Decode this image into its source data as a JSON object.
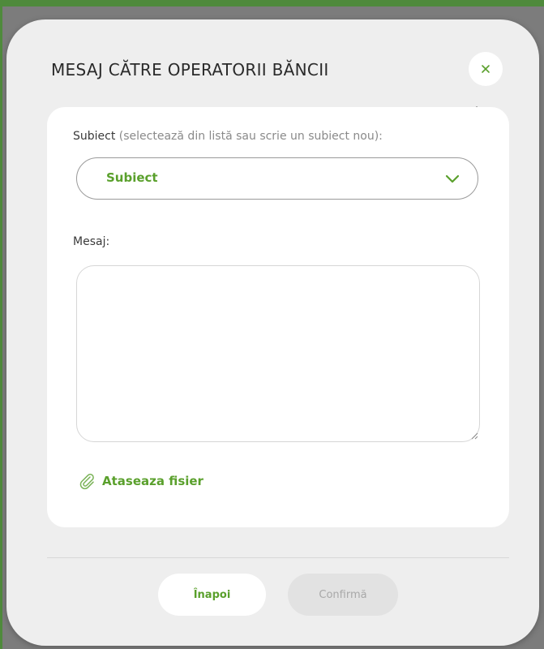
{
  "dialog": {
    "title": "MESAJ CĂTRE OPERATORII BĂNCII",
    "close_icon": "close-icon"
  },
  "form": {
    "subject_label": "Subiect",
    "subject_hint": "(selectează din listă sau scrie un subiect nou):",
    "subject_value": "Subiect",
    "message_label": "Mesaj:",
    "message_value": "",
    "attach_label": "Ataseaza fisier",
    "attach_icon": "paperclip-icon"
  },
  "actions": {
    "back_label": "Înapoi",
    "confirm_label": "Confirmă"
  },
  "colors": {
    "accent": "#5aa02c",
    "dialog_bg": "#eeeeee",
    "card_bg": "#ffffff",
    "disabled": "#e2e2e2"
  }
}
